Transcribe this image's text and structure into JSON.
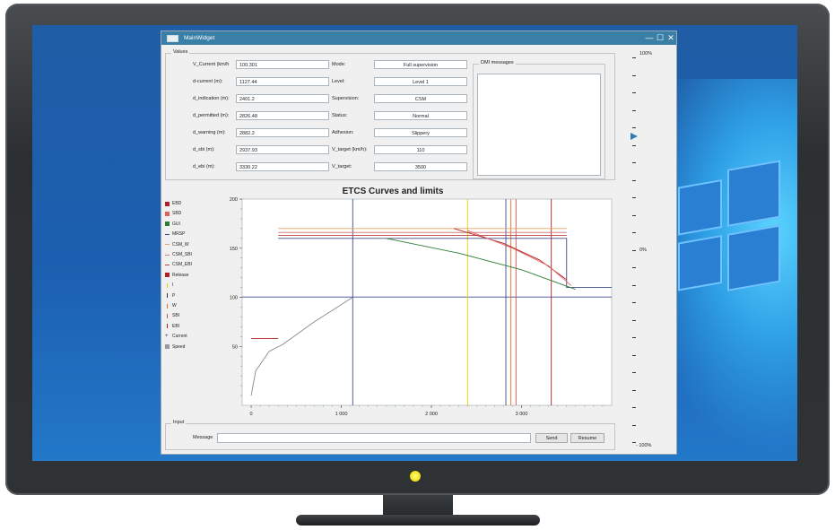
{
  "window": {
    "title": "MainWidget",
    "minimize": "—",
    "maximize": "☐",
    "close": "✕"
  },
  "values": {
    "group_title": "Values",
    "left": [
      {
        "label": "V_Current (km/h",
        "value": "100.301"
      },
      {
        "label": "d-current (m):",
        "value": "1127.44"
      },
      {
        "label": "d_indication (m):",
        "value": "2401.2"
      },
      {
        "label": "d_permitted (m):",
        "value": "2826.48"
      },
      {
        "label": "d_warning (m):",
        "value": "2882.2"
      },
      {
        "label": "d_sbi (m):",
        "value": "2937.93"
      },
      {
        "label": "d_ebi (m):",
        "value": "3330.22"
      }
    ],
    "right": [
      {
        "label": "Mode:",
        "value": "Full supervision"
      },
      {
        "label": "Level:",
        "value": "Level 1"
      },
      {
        "label": "Supervision:",
        "value": "CSM"
      },
      {
        "label": "Status:",
        "value": "Normal"
      },
      {
        "label": "Adhesion:",
        "value": "Slippery"
      },
      {
        "label": "V_target (km/h):",
        "value": "110"
      },
      {
        "label": "V_target:",
        "value": "3500"
      }
    ],
    "dmi_title": "DMI messages"
  },
  "chart_data": {
    "type": "line",
    "title": "ETCS Curves and limits",
    "xlim": [
      -100,
      4000
    ],
    "ylim": [
      -10,
      200
    ],
    "x_ticks": [
      "0",
      "1 000",
      "2 000",
      "3 000"
    ],
    "y_ticks": [
      "200",
      "150",
      "100",
      "50"
    ],
    "legend": [
      {
        "name": "EBD",
        "color": "#b22222",
        "kind": "box"
      },
      {
        "name": "SBD",
        "color": "#e06060",
        "kind": "box"
      },
      {
        "name": "GUI",
        "color": "#2e7d32",
        "kind": "box"
      },
      {
        "name": "MRSP",
        "color": "#3b4a8c",
        "kind": "line"
      },
      {
        "name": "CSM_W",
        "color": "#e8a060",
        "kind": "line"
      },
      {
        "name": "CSM_SBI",
        "color": "#d08080",
        "kind": "line"
      },
      {
        "name": "CSM_EBI",
        "color": "#c04040",
        "kind": "line"
      },
      {
        "name": "Release",
        "color": "#b22222",
        "kind": "box"
      },
      {
        "name": "I",
        "color": "#e8d000",
        "kind": "tick"
      },
      {
        "name": "P",
        "color": "#333333",
        "kind": "tick"
      },
      {
        "name": "W",
        "color": "#e07020",
        "kind": "tick"
      },
      {
        "name": "SBI",
        "color": "#d05050",
        "kind": "tick"
      },
      {
        "name": "EBI",
        "color": "#a02020",
        "kind": "tick"
      },
      {
        "name": "Current",
        "color": "#333333",
        "kind": "cross"
      },
      {
        "name": "Speed",
        "color": "#999999",
        "kind": "box"
      }
    ],
    "series": [
      {
        "name": "MRSP",
        "color": "#3b4a8c",
        "x": [
          300,
          3500,
          3500,
          4000
        ],
        "y": [
          160,
          160,
          110,
          110
        ]
      },
      {
        "name": "CSM_W",
        "color": "#e8a060",
        "x": [
          300,
          3500
        ],
        "y": [
          170,
          170
        ]
      },
      {
        "name": "CSM_SBI",
        "color": "#d08080",
        "x": [
          300,
          3500
        ],
        "y": [
          166,
          166
        ]
      },
      {
        "name": "CSM_EBI",
        "color": "#c04040",
        "x": [
          300,
          3500
        ],
        "y": [
          163,
          163
        ]
      },
      {
        "name": "EBD",
        "color": "#b22222",
        "x": [
          2250,
          2800,
          3200,
          3500
        ],
        "y": [
          170,
          155,
          138,
          118
        ]
      },
      {
        "name": "SBD",
        "color": "#e06060",
        "x": [
          2400,
          2900,
          3300,
          3550
        ],
        "y": [
          168,
          150,
          132,
          112
        ]
      },
      {
        "name": "GUI",
        "color": "#2e7d32",
        "x": [
          1500,
          2300,
          3000,
          3600
        ],
        "y": [
          160,
          145,
          128,
          108
        ]
      },
      {
        "name": "Speed",
        "color": "#888888",
        "x": [
          0,
          50,
          200,
          350,
          700,
          1127
        ],
        "y": [
          0,
          25,
          45,
          52,
          75,
          100
        ]
      },
      {
        "name": "Release",
        "color": "#b22222",
        "x": [
          0,
          300
        ],
        "y": [
          58,
          58
        ]
      }
    ],
    "vlines": [
      {
        "name": "Current",
        "x": 1127,
        "color": "#3b4a8c"
      },
      {
        "name": "I",
        "x": 2401,
        "color": "#e8d000"
      },
      {
        "name": "P",
        "x": 2826,
        "color": "#3b4a8c"
      },
      {
        "name": "W",
        "x": 2882,
        "color": "#e07020"
      },
      {
        "name": "SBI",
        "x": 2938,
        "color": "#d05050"
      },
      {
        "name": "EBI",
        "x": 3330,
        "color": "#a02020"
      }
    ],
    "hline_current": {
      "y": 100.301,
      "color": "#3b4a8c"
    }
  },
  "input": {
    "group_title": "Input",
    "message_label": "Message",
    "message_value": "",
    "send_label": "Send",
    "resume_label": "Resume"
  },
  "slider": {
    "top_label": "100%",
    "mid_label": "0%",
    "bottom_label": "- 100%",
    "value": 0.6
  }
}
